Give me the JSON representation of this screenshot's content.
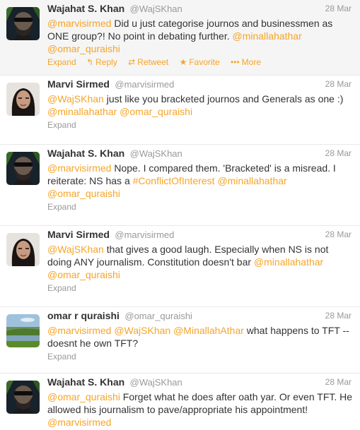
{
  "colors": {
    "link": "#f6a427",
    "meta": "#999999",
    "text": "#333333"
  },
  "actions": {
    "expand": "Expand",
    "reply": "Reply",
    "retweet": "Retweet",
    "favorite": "Favorite",
    "more": "More"
  },
  "tweets": [
    {
      "fullname": "Wajahat S. Khan",
      "username": "@WajSKhan",
      "time": "28 Mar",
      "avatar": "bearded-man-sunglasses-avatar",
      "segments": [
        {
          "t": "@marvisirmed",
          "link": true
        },
        {
          "t": " Did u just categorise journos and businessmen as ONE group?! No point in debating further. ",
          "link": false
        },
        {
          "t": "@minallahathar",
          "link": true
        },
        {
          "t": " ",
          "link": false
        },
        {
          "t": "@omar_quraishi",
          "link": true
        }
      ]
    },
    {
      "fullname": "Marvi Sirmed",
      "username": "@marvisirmed",
      "time": "28 Mar",
      "avatar": "woman-portrait-avatar",
      "segments": [
        {
          "t": "@WajSKhan",
          "link": true
        },
        {
          "t": " just like you bracketed journos and Generals as one :) ",
          "link": false
        },
        {
          "t": "@minallahathar",
          "link": true
        },
        {
          "t": " ",
          "link": false
        },
        {
          "t": "@omar_quraishi",
          "link": true
        }
      ]
    },
    {
      "fullname": "Wajahat S. Khan",
      "username": "@WajSKhan",
      "time": "28 Mar",
      "avatar": "bearded-man-sunglasses-avatar",
      "segments": [
        {
          "t": "@marvisirmed",
          "link": true
        },
        {
          "t": " Nope. I compared them. 'Bracketed' is a misread. I reiterate: NS has a ",
          "link": false
        },
        {
          "t": "#ConflictOfInterest",
          "link": true
        },
        {
          "t": " ",
          "link": false
        },
        {
          "t": "@minallahathar",
          "link": true
        },
        {
          "t": " ",
          "link": false
        },
        {
          "t": "@omar_quraishi",
          "link": true
        }
      ]
    },
    {
      "fullname": "Marvi Sirmed",
      "username": "@marvisirmed",
      "time": "28 Mar",
      "avatar": "woman-portrait-avatar",
      "segments": [
        {
          "t": "@WajSKhan",
          "link": true
        },
        {
          "t": " that gives a good laugh. Especially when NS is not doing ANY journalism. Constitution doesn't bar ",
          "link": false
        },
        {
          "t": "@minallahathar",
          "link": true
        },
        {
          "t": " ",
          "link": false
        },
        {
          "t": "@omar_quraishi",
          "link": true
        }
      ]
    },
    {
      "fullname": "omar r quraishi",
      "username": "@omar_quraishi",
      "time": "28 Mar",
      "avatar": "landscape-avatar",
      "segments": [
        {
          "t": "@marvisirmed",
          "link": true
        },
        {
          "t": " ",
          "link": false
        },
        {
          "t": "@WajSKhan",
          "link": true
        },
        {
          "t": " ",
          "link": false
        },
        {
          "t": "@MinallahAthar",
          "link": true
        },
        {
          "t": " what happens to TFT -- doesnt he own TFT?",
          "link": false
        }
      ]
    },
    {
      "fullname": "Wajahat S. Khan",
      "username": "@WajSKhan",
      "time": "28 Mar",
      "avatar": "bearded-man-sunglasses-avatar",
      "segments": [
        {
          "t": "@omar_quraishi",
          "link": true
        },
        {
          "t": " Forget what he does after oath yar. Or even TFT. He allowed his journalism to pave/appropriate his appointment! ",
          "link": false
        },
        {
          "t": "@marvisirmed",
          "link": true
        }
      ]
    }
  ]
}
